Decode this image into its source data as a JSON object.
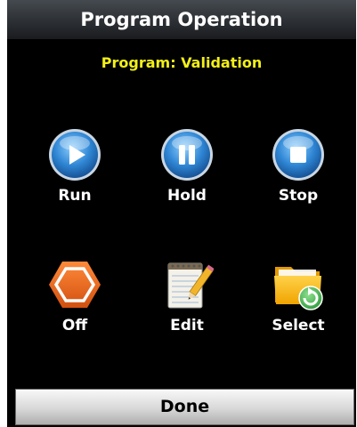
{
  "window": {
    "title": "Program Operation"
  },
  "program_label": "Program: Validation",
  "buttons": {
    "run": {
      "label": "Run",
      "icon": "play-icon"
    },
    "hold": {
      "label": "Hold",
      "icon": "pause-icon"
    },
    "stop": {
      "label": "Stop",
      "icon": "stop-icon"
    },
    "off": {
      "label": "Off",
      "icon": "hexagon-off-icon"
    },
    "edit": {
      "label": "Edit",
      "icon": "notepad-pencil-icon"
    },
    "select": {
      "label": "Select",
      "icon": "folder-refresh-icon"
    }
  },
  "footer": {
    "done_label": "Done"
  },
  "colors": {
    "background": "#000000",
    "title_text": "#ffffff",
    "program_text": "#f2ef1a",
    "circle_blue": "#2f86d4",
    "off_orange": "#e8651a",
    "folder_yellow": "#f5b400",
    "refresh_green": "#3cb44a"
  }
}
